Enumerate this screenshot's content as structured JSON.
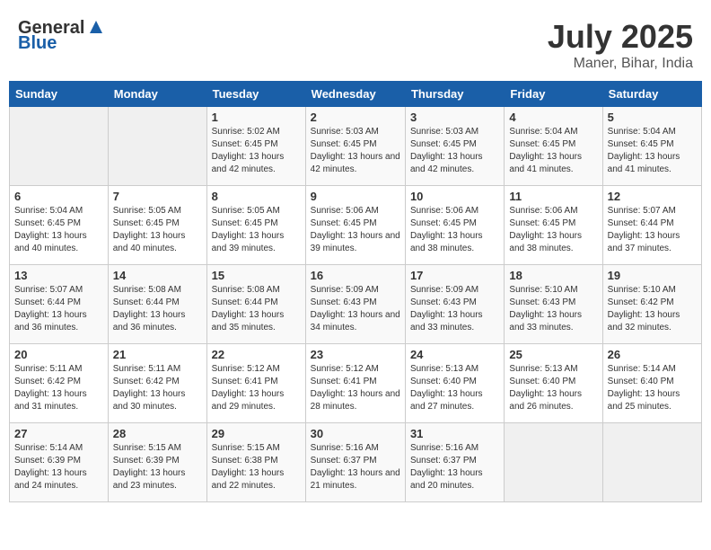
{
  "header": {
    "logo_general": "General",
    "logo_blue": "Blue",
    "month": "July 2025",
    "location": "Maner, Bihar, India"
  },
  "days_of_week": [
    "Sunday",
    "Monday",
    "Tuesday",
    "Wednesday",
    "Thursday",
    "Friday",
    "Saturday"
  ],
  "weeks": [
    [
      {
        "day": "",
        "info": ""
      },
      {
        "day": "",
        "info": ""
      },
      {
        "day": "1",
        "info": "Sunrise: 5:02 AM\nSunset: 6:45 PM\nDaylight: 13 hours\nand 42 minutes."
      },
      {
        "day": "2",
        "info": "Sunrise: 5:03 AM\nSunset: 6:45 PM\nDaylight: 13 hours\nand 42 minutes."
      },
      {
        "day": "3",
        "info": "Sunrise: 5:03 AM\nSunset: 6:45 PM\nDaylight: 13 hours\nand 42 minutes."
      },
      {
        "day": "4",
        "info": "Sunrise: 5:04 AM\nSunset: 6:45 PM\nDaylight: 13 hours\nand 41 minutes."
      },
      {
        "day": "5",
        "info": "Sunrise: 5:04 AM\nSunset: 6:45 PM\nDaylight: 13 hours\nand 41 minutes."
      }
    ],
    [
      {
        "day": "6",
        "info": "Sunrise: 5:04 AM\nSunset: 6:45 PM\nDaylight: 13 hours\nand 40 minutes."
      },
      {
        "day": "7",
        "info": "Sunrise: 5:05 AM\nSunset: 6:45 PM\nDaylight: 13 hours\nand 40 minutes."
      },
      {
        "day": "8",
        "info": "Sunrise: 5:05 AM\nSunset: 6:45 PM\nDaylight: 13 hours\nand 39 minutes."
      },
      {
        "day": "9",
        "info": "Sunrise: 5:06 AM\nSunset: 6:45 PM\nDaylight: 13 hours\nand 39 minutes."
      },
      {
        "day": "10",
        "info": "Sunrise: 5:06 AM\nSunset: 6:45 PM\nDaylight: 13 hours\nand 38 minutes."
      },
      {
        "day": "11",
        "info": "Sunrise: 5:06 AM\nSunset: 6:45 PM\nDaylight: 13 hours\nand 38 minutes."
      },
      {
        "day": "12",
        "info": "Sunrise: 5:07 AM\nSunset: 6:44 PM\nDaylight: 13 hours\nand 37 minutes."
      }
    ],
    [
      {
        "day": "13",
        "info": "Sunrise: 5:07 AM\nSunset: 6:44 PM\nDaylight: 13 hours\nand 36 minutes."
      },
      {
        "day": "14",
        "info": "Sunrise: 5:08 AM\nSunset: 6:44 PM\nDaylight: 13 hours\nand 36 minutes."
      },
      {
        "day": "15",
        "info": "Sunrise: 5:08 AM\nSunset: 6:44 PM\nDaylight: 13 hours\nand 35 minutes."
      },
      {
        "day": "16",
        "info": "Sunrise: 5:09 AM\nSunset: 6:43 PM\nDaylight: 13 hours\nand 34 minutes."
      },
      {
        "day": "17",
        "info": "Sunrise: 5:09 AM\nSunset: 6:43 PM\nDaylight: 13 hours\nand 33 minutes."
      },
      {
        "day": "18",
        "info": "Sunrise: 5:10 AM\nSunset: 6:43 PM\nDaylight: 13 hours\nand 33 minutes."
      },
      {
        "day": "19",
        "info": "Sunrise: 5:10 AM\nSunset: 6:42 PM\nDaylight: 13 hours\nand 32 minutes."
      }
    ],
    [
      {
        "day": "20",
        "info": "Sunrise: 5:11 AM\nSunset: 6:42 PM\nDaylight: 13 hours\nand 31 minutes."
      },
      {
        "day": "21",
        "info": "Sunrise: 5:11 AM\nSunset: 6:42 PM\nDaylight: 13 hours\nand 30 minutes."
      },
      {
        "day": "22",
        "info": "Sunrise: 5:12 AM\nSunset: 6:41 PM\nDaylight: 13 hours\nand 29 minutes."
      },
      {
        "day": "23",
        "info": "Sunrise: 5:12 AM\nSunset: 6:41 PM\nDaylight: 13 hours\nand 28 minutes."
      },
      {
        "day": "24",
        "info": "Sunrise: 5:13 AM\nSunset: 6:40 PM\nDaylight: 13 hours\nand 27 minutes."
      },
      {
        "day": "25",
        "info": "Sunrise: 5:13 AM\nSunset: 6:40 PM\nDaylight: 13 hours\nand 26 minutes."
      },
      {
        "day": "26",
        "info": "Sunrise: 5:14 AM\nSunset: 6:40 PM\nDaylight: 13 hours\nand 25 minutes."
      }
    ],
    [
      {
        "day": "27",
        "info": "Sunrise: 5:14 AM\nSunset: 6:39 PM\nDaylight: 13 hours\nand 24 minutes."
      },
      {
        "day": "28",
        "info": "Sunrise: 5:15 AM\nSunset: 6:39 PM\nDaylight: 13 hours\nand 23 minutes."
      },
      {
        "day": "29",
        "info": "Sunrise: 5:15 AM\nSunset: 6:38 PM\nDaylight: 13 hours\nand 22 minutes."
      },
      {
        "day": "30",
        "info": "Sunrise: 5:16 AM\nSunset: 6:37 PM\nDaylight: 13 hours\nand 21 minutes."
      },
      {
        "day": "31",
        "info": "Sunrise: 5:16 AM\nSunset: 6:37 PM\nDaylight: 13 hours\nand 20 minutes."
      },
      {
        "day": "",
        "info": ""
      },
      {
        "day": "",
        "info": ""
      }
    ]
  ]
}
